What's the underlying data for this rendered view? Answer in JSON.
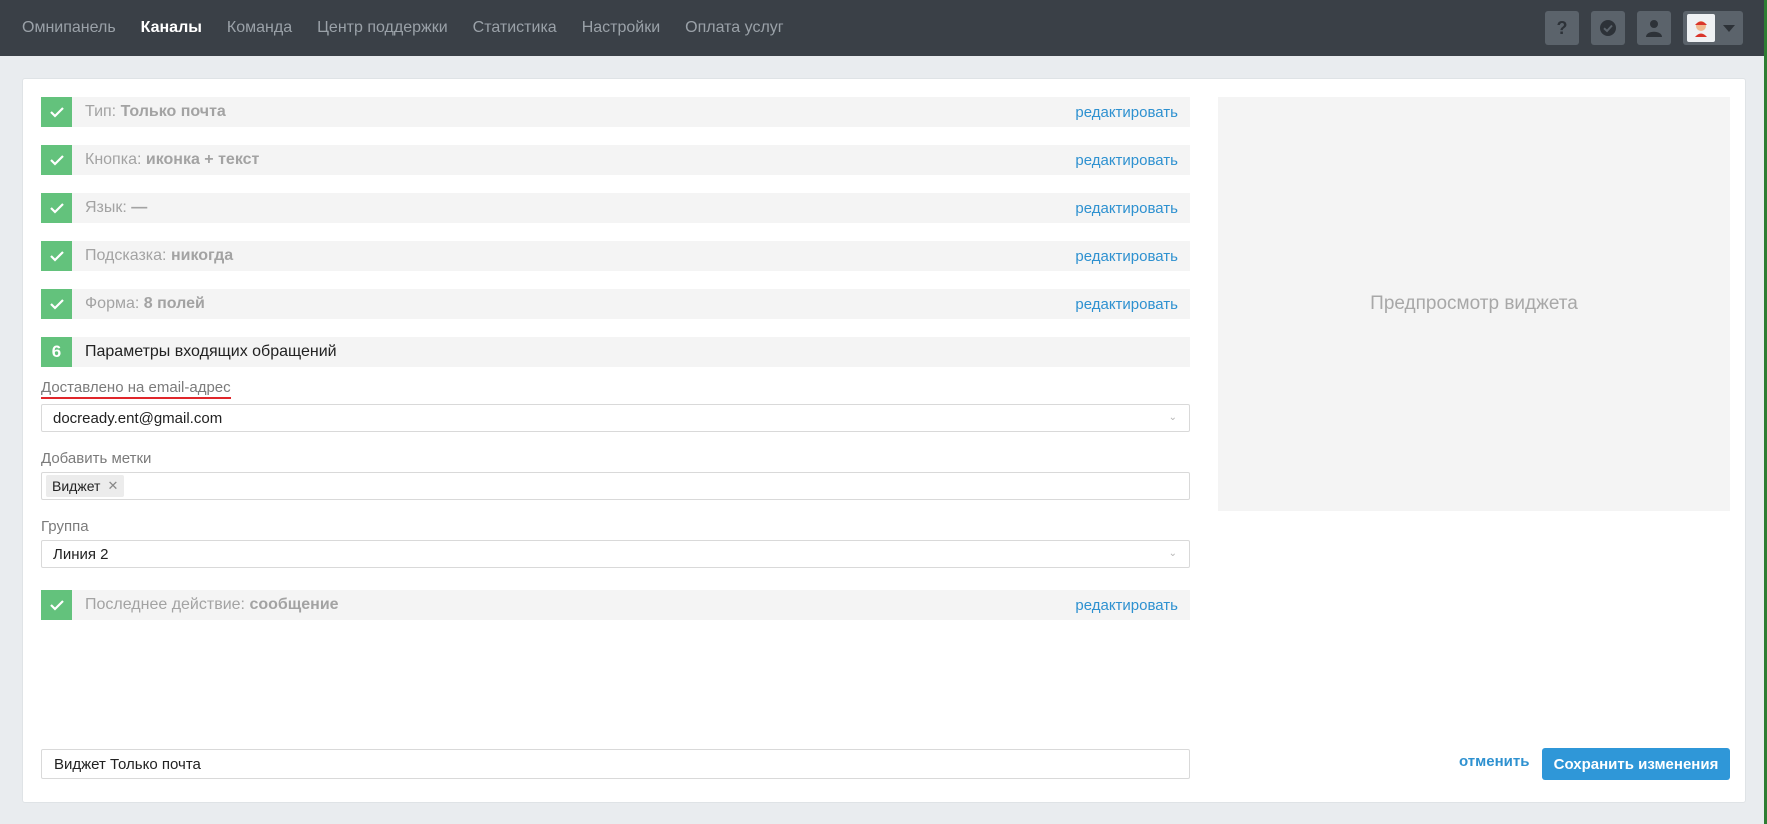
{
  "nav": {
    "items": [
      {
        "label": "Омнипанель",
        "active": false
      },
      {
        "label": "Каналы",
        "active": true
      },
      {
        "label": "Команда",
        "active": false
      },
      {
        "label": "Центр поддержки",
        "active": false
      },
      {
        "label": "Статистика",
        "active": false
      },
      {
        "label": "Настройки",
        "active": false
      },
      {
        "label": "Оплата услуг",
        "active": false
      }
    ]
  },
  "top_icons": {
    "help": "?",
    "icons": [
      "help-icon",
      "check-badge-icon",
      "user-icon",
      "avatar"
    ]
  },
  "steps": [
    {
      "prefix": "Тип:",
      "value": "Только почта",
      "edit": "редактировать"
    },
    {
      "prefix": "Кнопка:",
      "value": "иконка + текст",
      "edit": "редактировать"
    },
    {
      "prefix": "Язык:",
      "value": "—",
      "edit": "редактировать"
    },
    {
      "prefix": "Подсказка:",
      "value": "никогда",
      "edit": "редактировать"
    },
    {
      "prefix": "Форма:",
      "value": "8 полей",
      "edit": "редактировать"
    }
  ],
  "active_step": {
    "number": "6",
    "title": "Параметры входящих обращений"
  },
  "fields": {
    "email_label": "Доставлено на email-адрес",
    "email_value": "docready.ent@gmail.com",
    "tags_label": "Добавить метки",
    "tag": "Виджет",
    "group_label": "Группа",
    "group_value": "Линия 2"
  },
  "last_step": {
    "prefix": "Последнее действие:",
    "value": "сообщение",
    "edit": "редактировать"
  },
  "widget_name": "Виджет Только почта",
  "preview_text": "Предпросмотр виджета",
  "actions": {
    "cancel": "отменить",
    "save": "Сохранить изменения"
  },
  "colors": {
    "accent": "#2f97d8",
    "check": "#63c27c",
    "topbar": "#3a4047"
  }
}
